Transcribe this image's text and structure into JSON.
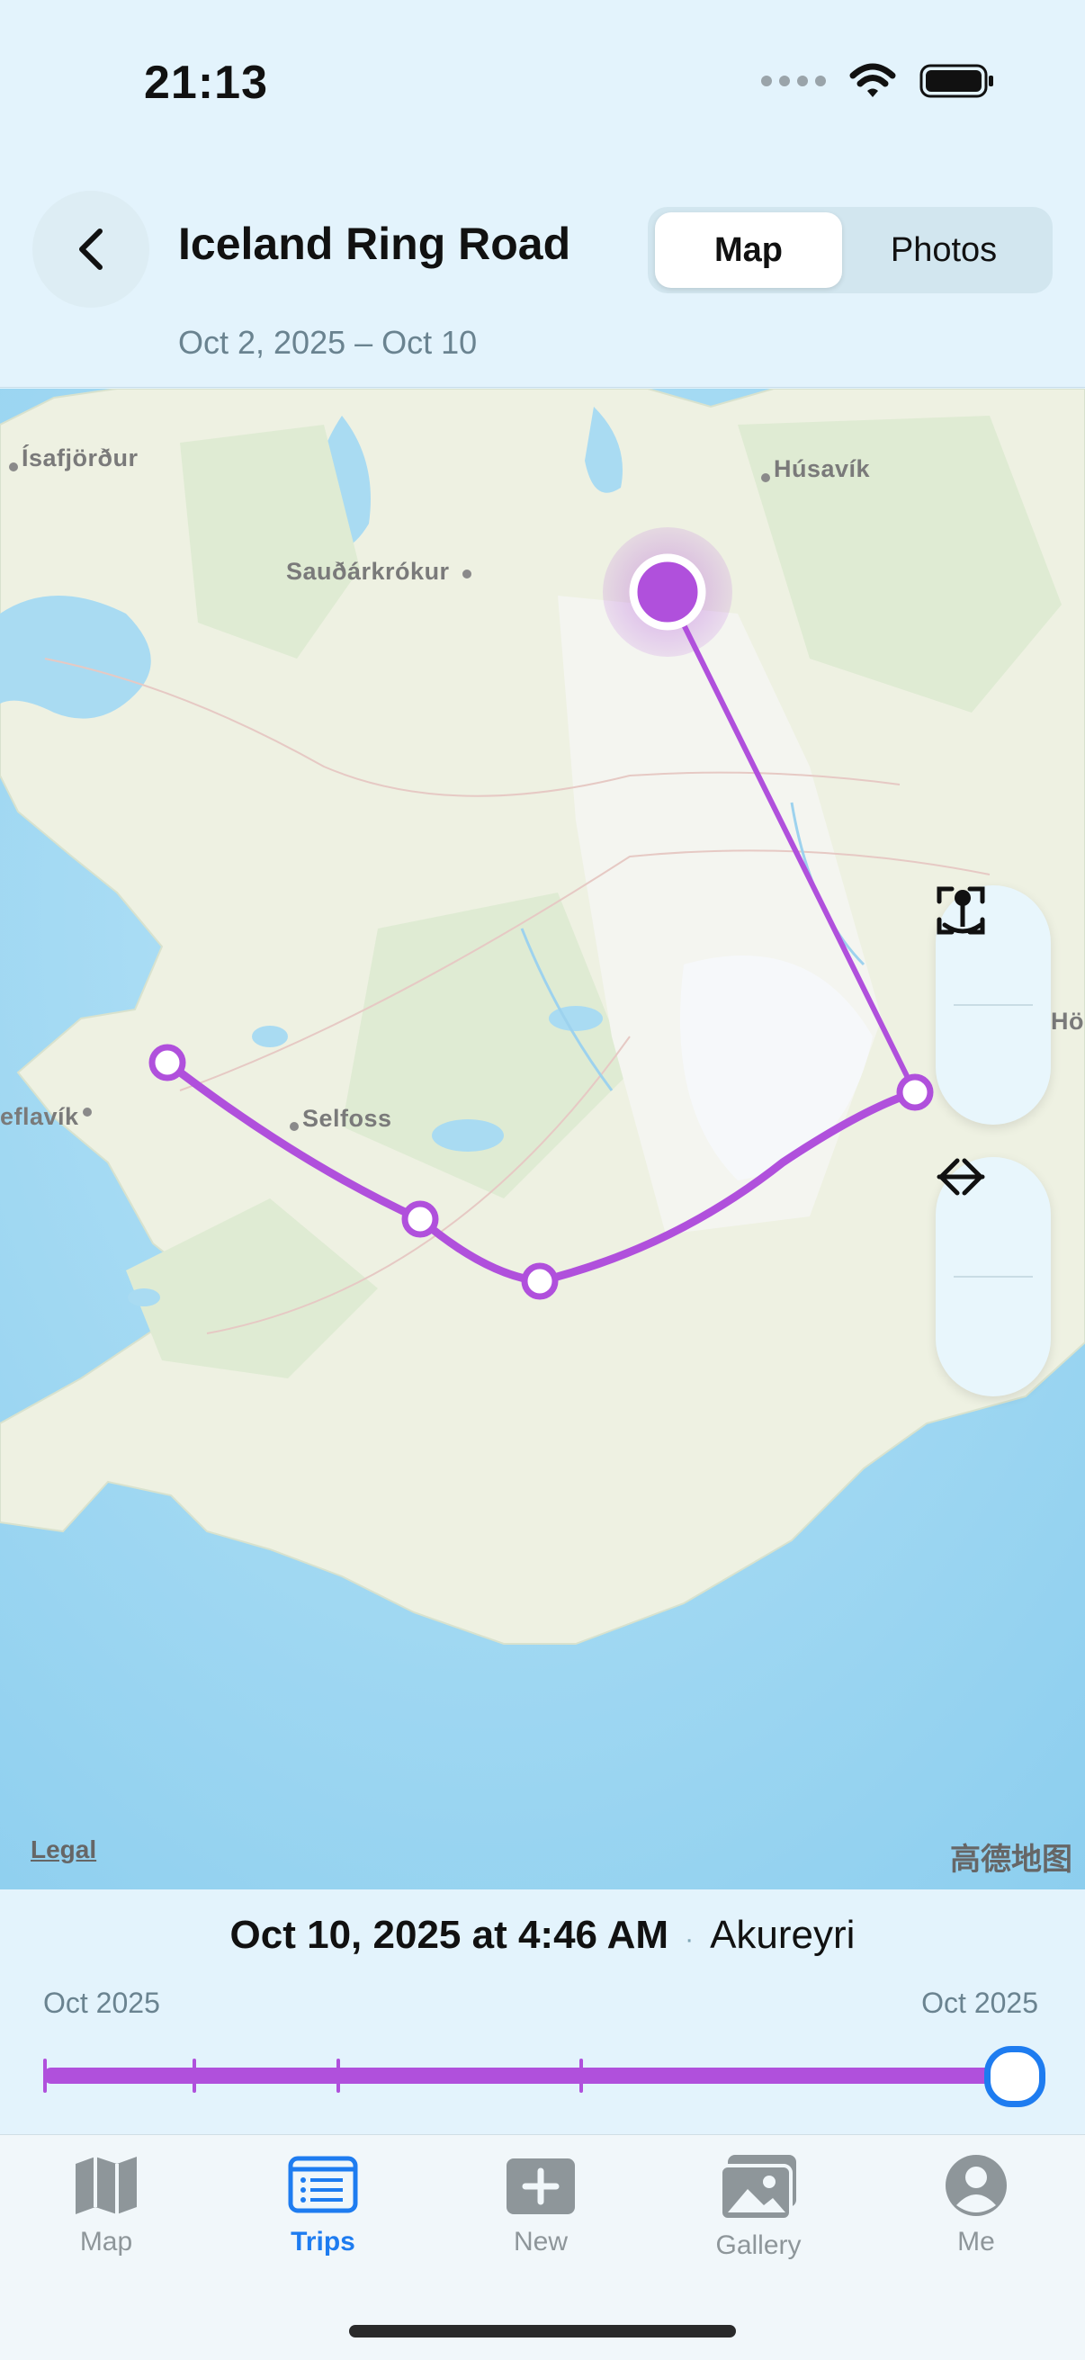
{
  "status_bar": {
    "time": "21:13"
  },
  "header": {
    "title": "Iceland Ring Road",
    "dates": "Oct 2, 2025 – Oct 10",
    "segments": [
      {
        "label": "Map",
        "selected": true
      },
      {
        "label": "Photos",
        "selected": false
      }
    ]
  },
  "map": {
    "places": [
      "Ísafjörður",
      "Húsavík",
      "Sauðárkrókur",
      "Selfoss",
      "eflavík",
      "Hö"
    ],
    "legal": "Legal",
    "provider": "高德地图",
    "route_color": "#B050DC"
  },
  "map_controls": [
    "location-pin-icon",
    "fit-bounds-icon",
    "next-arrow-icon",
    "previous-arrow-icon"
  ],
  "timeline": {
    "current_date": "Oct 10, 2025 at 4:46 AM",
    "separator": "·",
    "current_place": "Akureyri",
    "start_label": "Oct 2025",
    "end_label": "Oct 2025",
    "position": 1.0,
    "accent": "#1E7CF0"
  },
  "tabs": [
    {
      "label": "Map",
      "icon": "map-icon",
      "active": false
    },
    {
      "label": "Trips",
      "icon": "trips-list-icon",
      "active": true
    },
    {
      "label": "New",
      "icon": "plus-icon",
      "active": false
    },
    {
      "label": "Gallery",
      "icon": "gallery-icon",
      "active": false
    },
    {
      "label": "Me",
      "icon": "person-icon",
      "active": false
    }
  ]
}
